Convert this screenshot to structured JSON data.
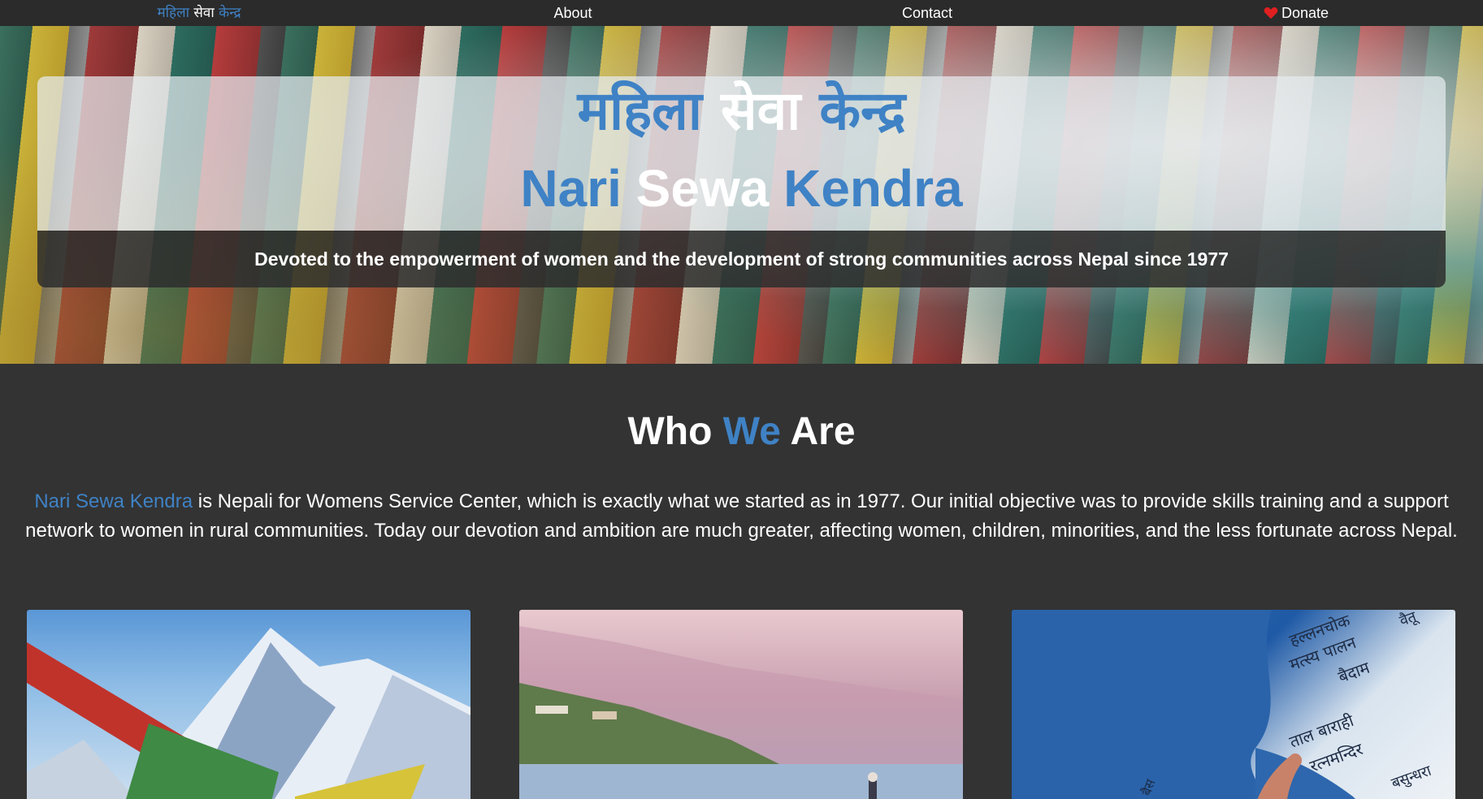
{
  "nav": {
    "brand_part1": "महिला",
    "brand_part2": "सेवा",
    "brand_part3": "केन्द्र",
    "about": "About",
    "contact": "Contact",
    "donate": "Donate"
  },
  "hero": {
    "nepali_part1": "महिला",
    "nepali_part2": "सेवा",
    "nepali_part3": "केन्द्र",
    "english_part1": "Nari",
    "english_part2": "Sewa",
    "english_part3": "Kendra",
    "tagline": "Devoted to the empowerment of women and the development of strong communities across Nepal since 1977"
  },
  "about": {
    "title_part1": "Who",
    "title_part2": "We",
    "title_part3": "Are",
    "intro_highlight": "Nari Sewa Kendra",
    "intro_line1": " is Nepali for Womens Service Center, which is exactly what we started as in 1977. Our initial objective was to provide skills training and a support",
    "intro_line2": "network to women in rural communities. Today our devotion and ambition are much greater, affecting women, children, minorities, and the less fortunate across Nepal."
  },
  "photos": {
    "map_labels": [
      "हल्लनचोक",
      "मत्स्य पालन",
      "बैदाम",
      "ताल बाराही",
      "रत्नमन्दिर",
      "बसुन्धरा",
      "बैस",
      "वैतू"
    ]
  },
  "colors": {
    "accent": "#3f82c5",
    "background": "#333333",
    "nav_background": "#2b2b2b",
    "heart": "#e02020"
  }
}
